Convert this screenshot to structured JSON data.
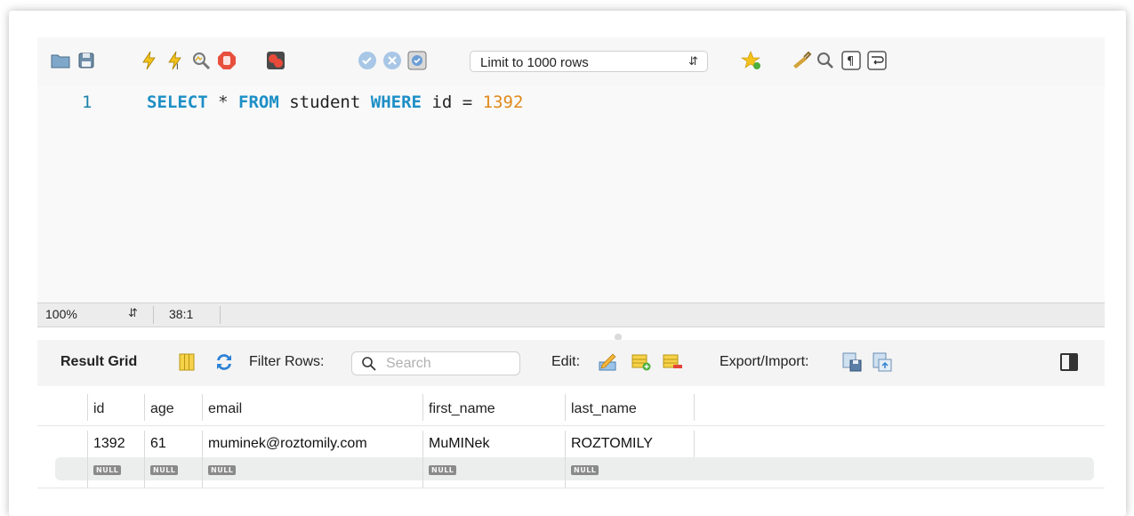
{
  "toolbar": {
    "limit_select": {
      "value": "Limit to 1000 rows"
    },
    "icons": [
      "folder-open-icon",
      "save-icon",
      "execute-icon",
      "execute-current-icon",
      "explain-icon",
      "stop-icon",
      "toggle-continue-on-error-icon",
      "commit-icon",
      "rollback-icon",
      "autocommit-icon",
      "add-snippet-icon",
      "beautify-icon",
      "find-icon",
      "invisible-chars-icon",
      "wrap-icon"
    ]
  },
  "editor": {
    "line_number": "1",
    "tokens": {
      "kw_select": "SELECT",
      "star": "*",
      "kw_from": "FROM",
      "table": "student",
      "kw_where": "WHERE",
      "column": "id",
      "eq": "=",
      "value": "1392"
    }
  },
  "status_bar": {
    "zoom": "100%",
    "cursor": "38:1"
  },
  "result_toolbar": {
    "result_grid_label": "Result Grid",
    "filter_rows_label": "Filter Rows:",
    "search_placeholder": "Search",
    "edit_label": "Edit:",
    "export_import_label": "Export/Import:"
  },
  "grid": {
    "columns": [
      "id",
      "age",
      "email",
      "first_name",
      "last_name"
    ],
    "rows": [
      [
        "1392",
        "61",
        "muminek@roztomily.com",
        "MuMINek",
        "ROZTOMILY"
      ]
    ],
    "new_row": [
      "NULL",
      "NULL",
      "NULL",
      "NULL",
      "NULL"
    ]
  },
  "colors": {
    "keyword": "#1d8fc6",
    "number": "#e08a1c",
    "line_number": "#1a82a8"
  }
}
